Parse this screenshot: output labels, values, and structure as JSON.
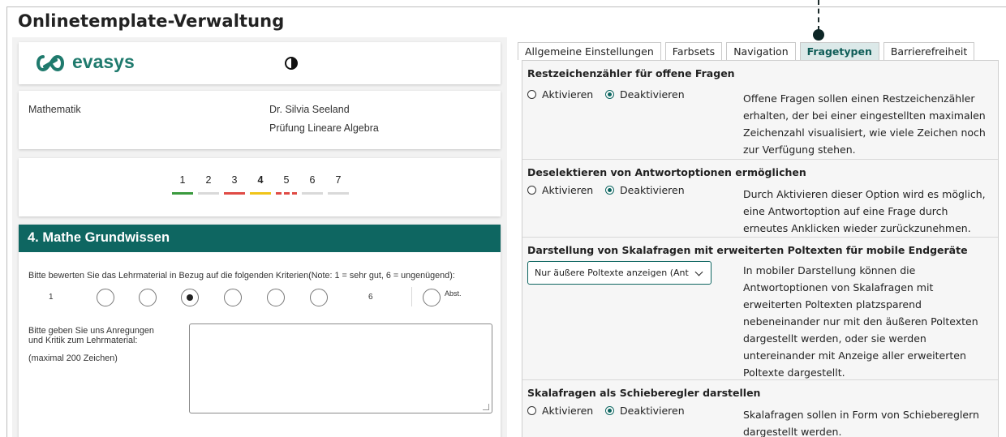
{
  "page": {
    "title": "Onlinetemplate-Verwaltung"
  },
  "preview": {
    "logo_text": "evasys",
    "subject": "Mathematik",
    "teacher": "Dr. Silvia Seeland",
    "exam": "Prüfung Lineare Algebra",
    "pages": [
      {
        "label": "1",
        "status_color": "#3a9a3e"
      },
      {
        "label": "2",
        "status_color": "#d9d9d9"
      },
      {
        "label": "3",
        "status_color": "#e04b45"
      },
      {
        "label": "4",
        "status_color": "#f0c419",
        "current": true
      },
      {
        "label": "5",
        "status_color": "#e04b45"
      },
      {
        "label": "6",
        "status_color": "#d9d9d9"
      },
      {
        "label": "7",
        "status_color": "#d9d9d9"
      }
    ],
    "section_title": "4. Mathe Grundwissen",
    "question": "Bitte bewerten Sie das Lehrmaterial in Bezug auf die folgenden Kriterien(Note: 1 = sehr gut, 6 = ungenügend):",
    "scale_min": "1",
    "scale_max": "6",
    "scale_abst": "Abst.",
    "selected_option": 3,
    "comment_line1": "Bitte geben Sie uns Anregungen",
    "comment_line2": "und Kritik zum Lehrmaterial:",
    "comment_limit": "(maximal 200 Zeichen)"
  },
  "tabs": [
    {
      "label": "Allgemeine Einstellungen",
      "active": false
    },
    {
      "label": "Farbsets",
      "active": false
    },
    {
      "label": "Navigation",
      "active": false
    },
    {
      "label": "Fragetypen",
      "active": true
    },
    {
      "label": "Barrierefreiheit",
      "active": false
    }
  ],
  "settings": {
    "restzeichen": {
      "title": "Restzeichenzähler für offene Fragen",
      "activate": "Aktivieren",
      "deactivate": "Deaktivieren",
      "selected": "deactivate",
      "description": "Offene Fragen sollen einen Restzeichenzähler erhalten, der bei einer eingestellten maximalen Zeichenzahl visualisiert, wie viele Zeichen noch zur Verfügung stehen."
    },
    "deselect": {
      "title": "Deselektieren von Antwortoptionen ermöglichen",
      "activate": "Aktivieren",
      "deactivate": "Deaktivieren",
      "selected": "deactivate",
      "description": "Durch Aktivieren dieser Option wird es möglich, eine Antwortoption auf eine Frage durch erneutes Anklicken wieder zurückzunehmen."
    },
    "poltexte": {
      "title": "Darstellung von Skalafragen mit erweiterten Poltexten für mobile Endgeräte",
      "select_value": "Nur äußere Poltexte anzeigen (Ant",
      "description": "In mobiler Darstellung können die Antwortoptionen von Skalafragen mit erweiterten Poltexten platzsparend nebeneinander nur mit den äußeren Poltexten dargestellt werden, oder sie werden untereinander mit Anzeige aller erweiterten Poltexte dargestellt."
    },
    "schieberegler": {
      "title": "Skalafragen als Schieberegler darstellen",
      "activate": "Aktivieren",
      "deactivate": "Deaktivieren",
      "selected": "deactivate",
      "description": "Skalafragen sollen in Form von Schiebereglern dargestellt werden."
    }
  },
  "colors": {
    "brand": "#0e6661",
    "logo": "#1f7a6d",
    "active_tab_bg": "#dce9e9"
  }
}
